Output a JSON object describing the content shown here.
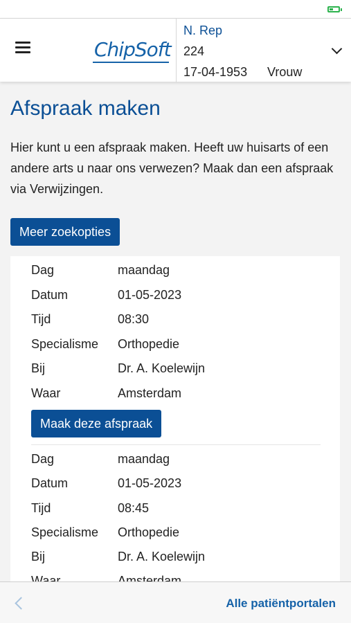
{
  "app": {
    "logo_text": "ChipSoft"
  },
  "patient": {
    "name": "N. Rep",
    "number": "224",
    "dob": "17-04-1953",
    "gender": "Vrouw"
  },
  "page": {
    "title": "Afspraak maken",
    "intro": "Hier kunt u een afspraak maken. Heeft uw huisarts of een andere arts u naar ons verwezen? Maak dan een afspraak via Verwijzingen.",
    "search_button": "Meer zoekopties"
  },
  "labels": {
    "day": "Dag",
    "date": "Datum",
    "time": "Tijd",
    "specialty": "Specialisme",
    "with": "Bij",
    "where": "Waar"
  },
  "appointments": [
    {
      "day": "maandag",
      "date": "01-05-2023",
      "time": "08:30",
      "specialty": "Orthopedie",
      "with": "Dr. A. Koelewijn",
      "where": "Amsterdam",
      "button": "Maak deze afspraak"
    },
    {
      "day": "maandag",
      "date": "01-05-2023",
      "time": "08:45",
      "specialty": "Orthopedie",
      "with": "Dr. A. Koelewijn",
      "where": "Amsterdam"
    }
  ],
  "footer": {
    "portals_link": "Alle patiëntportalen"
  },
  "colors": {
    "accent": "#0b4f95",
    "logo": "#1562a8",
    "battery": "#2bb24c"
  }
}
